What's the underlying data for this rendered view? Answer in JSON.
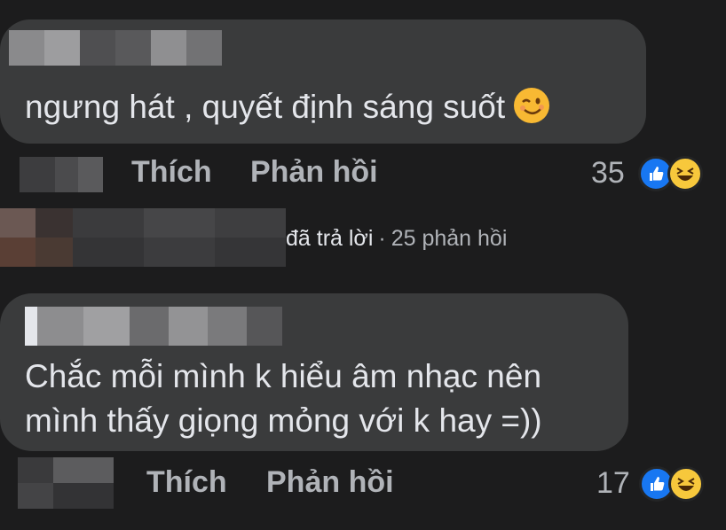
{
  "comments": [
    {
      "text": "ngưng hát , quyết định sáng suốt",
      "emoji": "winking-face-emoji",
      "like_label": "Thích",
      "reply_label": "Phản hồi",
      "reaction_count": "35",
      "reactions": [
        "like-icon",
        "haha-icon"
      ]
    },
    {
      "text_line1": "Chắc mỗi mình k hiểu âm nhạc nên",
      "text_line2": "mình thấy giọng mỏng với k hay =))",
      "like_label": "Thích",
      "reply_label": "Phản hồi",
      "reaction_count": "17",
      "reactions": [
        "like-icon",
        "haha-icon"
      ]
    }
  ],
  "reply_summary": {
    "replied_text": "đã trả lời",
    "separator": "·",
    "replies_count_text": "25 phản hồi"
  },
  "colors": {
    "background": "#1c1c1d",
    "bubble": "#3a3b3c",
    "text": "#e4e6eb",
    "secondary_text": "#b0b3b8",
    "like_blue": "#1877f2",
    "haha_yellow": "#f7c83c"
  }
}
